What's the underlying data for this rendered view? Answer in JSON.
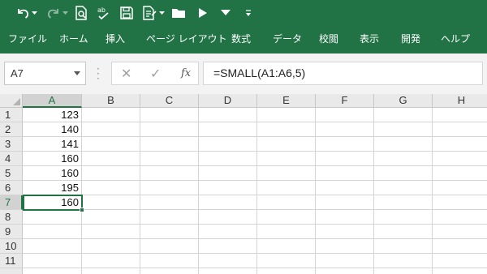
{
  "ribbon": {
    "qat_icons": [
      "undo-icon",
      "undo-dropdown-icon",
      "redo-icon",
      "redo-dropdown-icon",
      "print-preview-icon",
      "spelling-icon",
      "save-icon",
      "form-icon",
      "form-dropdown-icon",
      "open-folder-icon",
      "play-icon",
      "dropdown-icon",
      "customize-qat-icon"
    ],
    "tabs": [
      "ファイル",
      "ホーム",
      "挿入",
      "ページ レイアウト",
      "数式",
      "データ",
      "校閲",
      "表示",
      "開発",
      "ヘルプ"
    ],
    "color": "#217346"
  },
  "namebox": {
    "value": "A7"
  },
  "formula_bar": {
    "cancel_symbol": "✕",
    "enter_symbol": "✓",
    "fx_symbol": "fx",
    "formula": "=SMALL(A1:A6,5)"
  },
  "sheet": {
    "columns": [
      "A",
      "B",
      "C",
      "D",
      "E",
      "F",
      "G",
      "H"
    ],
    "rows": [
      "1",
      "2",
      "3",
      "4",
      "5",
      "6",
      "7",
      "8",
      "9",
      "10",
      "11"
    ],
    "column_a": [
      "123",
      "140",
      "141",
      "160",
      "160",
      "195",
      "160",
      "",
      "",
      "",
      ""
    ],
    "selected_cell": "A7"
  }
}
